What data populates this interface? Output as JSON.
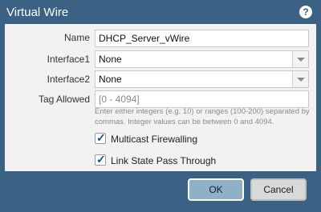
{
  "window": {
    "title": "Virtual Wire",
    "help_icon": "?"
  },
  "form": {
    "name": {
      "label": "Name",
      "value": "DHCP_Server_vWire"
    },
    "interface1": {
      "label": "Interface1",
      "value": "None"
    },
    "interface2": {
      "label": "Interface2",
      "value": "None"
    },
    "tag_allowed": {
      "label": "Tag Allowed",
      "placeholder": "[0 - 4094]",
      "help": "Enter either integers (e.g. 10) or ranges (100-200) separated by commas. Integer values can be between 0 and 4094."
    },
    "multicast_firewalling": {
      "label": "Multicast Firewalling",
      "checked": true
    },
    "link_state_pass_through": {
      "label": "Link State Pass Through",
      "checked": true
    }
  },
  "buttons": {
    "ok": "OK",
    "cancel": "Cancel"
  },
  "colors": {
    "titlebar": "#3b6184",
    "panel": "#f2f2f2",
    "ok_button": "#8fb0c9"
  }
}
